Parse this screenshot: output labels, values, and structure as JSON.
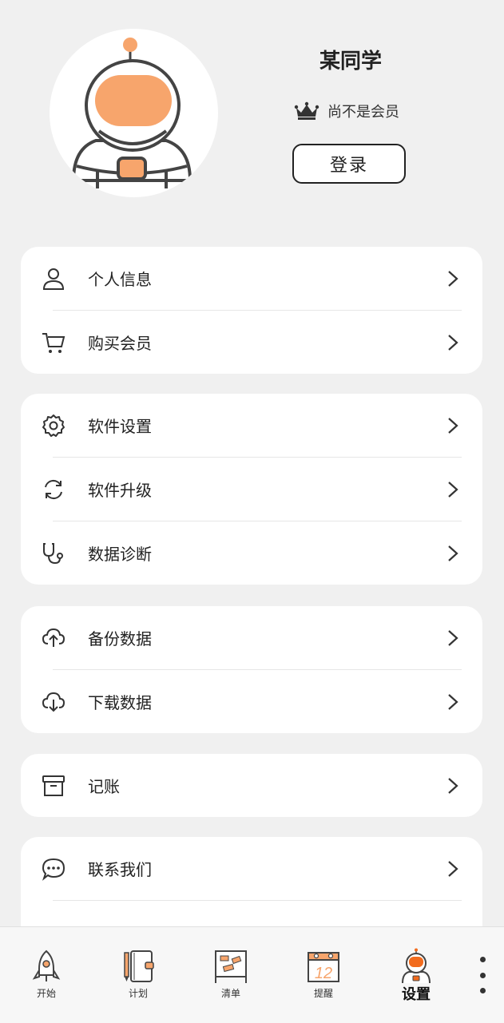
{
  "profile": {
    "name": "某同学",
    "member_status": "尚不是会员",
    "login_label": "登录"
  },
  "groups": [
    {
      "items": [
        {
          "label": "个人信息",
          "icon": "user-icon"
        },
        {
          "label": "购买会员",
          "icon": "cart-icon"
        }
      ]
    },
    {
      "items": [
        {
          "label": "软件设置",
          "icon": "gear-icon"
        },
        {
          "label": "软件升级",
          "icon": "refresh-icon"
        },
        {
          "label": "数据诊断",
          "icon": "stethoscope-icon"
        }
      ]
    },
    {
      "items": [
        {
          "label": "备份数据",
          "icon": "cloud-upload-icon"
        },
        {
          "label": "下载数据",
          "icon": "cloud-download-icon"
        }
      ]
    },
    {
      "items": [
        {
          "label": "记账",
          "icon": "archive-box-icon"
        }
      ]
    },
    {
      "items": [
        {
          "label": "联系我们",
          "icon": "chat-bubble-icon"
        }
      ]
    }
  ],
  "tabs": [
    {
      "label": "开始",
      "icon": "rocket-icon"
    },
    {
      "label": "计划",
      "icon": "notebook-icon"
    },
    {
      "label": "清单",
      "icon": "board-icon"
    },
    {
      "label": "提醒",
      "icon": "calendar-icon"
    },
    {
      "label": "设置",
      "icon": "astronaut-icon",
      "active": true
    }
  ],
  "colors": {
    "accent": "#f7a56c",
    "accent_dark": "#f26b1d",
    "background": "#f0f0f0"
  }
}
